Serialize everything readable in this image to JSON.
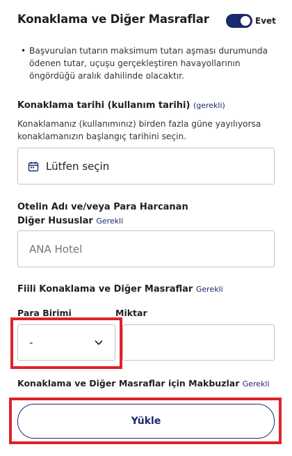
{
  "section": {
    "title": "Konaklama ve Diğer Masraflar",
    "toggle_label": "Evet"
  },
  "note": {
    "bullet": "•",
    "text": "Başvurulan tutarın maksimum tutarı aşması durumunda ödenen tutar, uçuşu gerçekleştiren havayollarının öngördüğü aralık dahilinde olacaktır."
  },
  "accommodation_date": {
    "label": "Konaklama tarihi (kullanım tarihi)",
    "required": "(gerekli)",
    "help": "Konaklamanız (kullanımınız) birden fazla güne yayılıyorsa konaklamanızın başlangıç tarihini seçin.",
    "value": "Lütfen seçin"
  },
  "hotel": {
    "label": "Otelin Adı ve/veya Para Harcanan Diğer Hususlar",
    "required": "Gerekli",
    "placeholder": "ANA Hotel"
  },
  "expenses": {
    "label": "Fiili Konaklama ve Diğer Masraflar",
    "required": "Gerekli",
    "currency_label": "Para Birimi",
    "currency_value": "-",
    "amount_label": "Miktar",
    "amount_value": ""
  },
  "receipts": {
    "label": "Konaklama ve Diğer Masraflar için Makbuzlar",
    "required": "Gerekli",
    "upload_label": "Yükle"
  },
  "colors": {
    "primary": "#1a2a6c",
    "highlight": "#e0222a",
    "border": "#c4c4c4"
  }
}
